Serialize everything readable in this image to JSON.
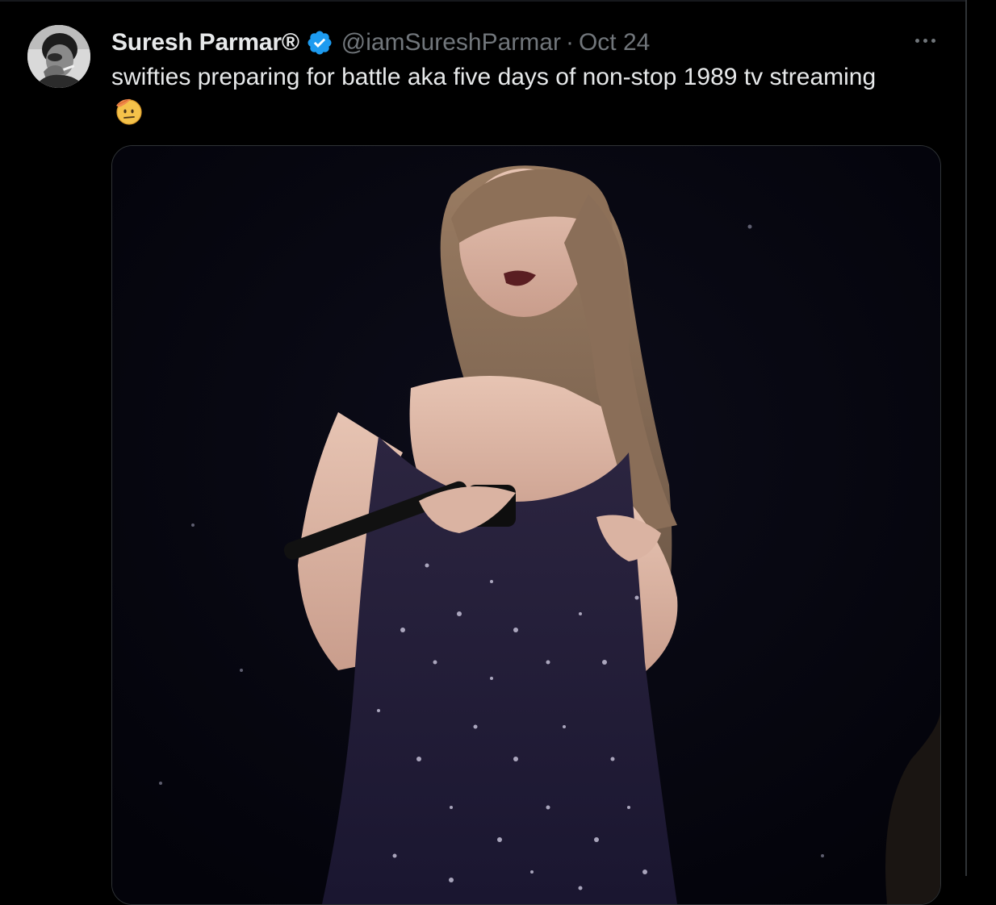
{
  "tweet": {
    "author": {
      "display_name": "Suresh Parmar®",
      "handle": "@iamSureshParmar",
      "avatar_icon": "avatar-photo-icon",
      "verified_icon": "verified-badge-icon"
    },
    "separator": "·",
    "date": "Oct 24",
    "text": "swifties preparing for battle aka five days of non-stop 1989 tv streaming",
    "emoji_icon": "saluting-face-emoji-icon",
    "more_icon": "more-options-icon",
    "media": {
      "type": "gif"
    }
  },
  "colors": {
    "background": "#000000",
    "text_primary": "#e7e9ea",
    "text_secondary": "#71767b",
    "verified_blue": "#1d9bf0",
    "border": "#2f3336"
  }
}
